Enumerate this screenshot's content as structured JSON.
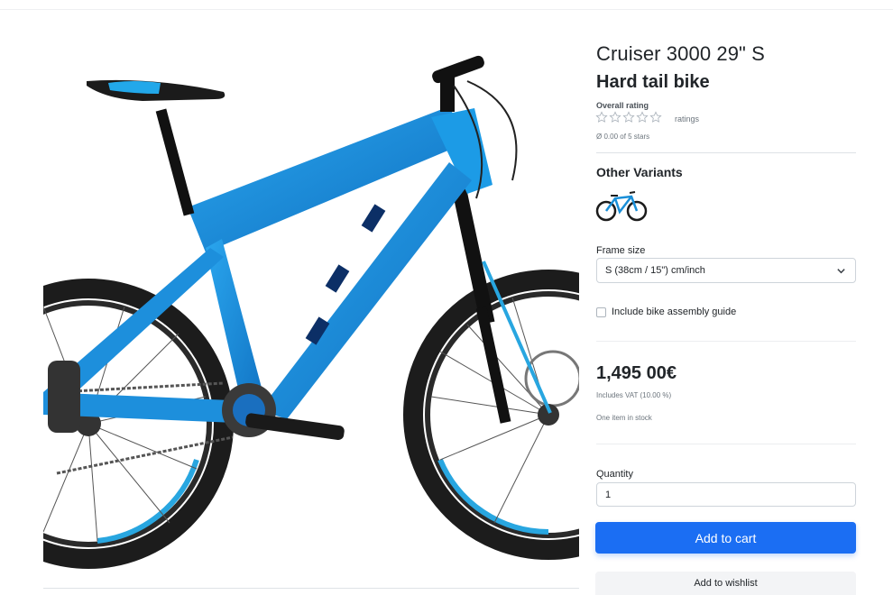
{
  "product": {
    "title": "Cruiser 3000 29\" S",
    "subtitle": "Hard tail bike",
    "image_name": "mountain bike photo",
    "accent_color": "#1b6ef3",
    "frame_color": "#1a8fd8"
  },
  "rating": {
    "title": "Overall rating",
    "stars_filled": 0,
    "stars_total": 5,
    "ratings_label": "ratings",
    "average_text": "Ø 0.00 of 5 stars"
  },
  "variants": {
    "title": "Other Variants",
    "items": [
      {
        "icon": "bike-thumbnail-icon"
      }
    ]
  },
  "frame_size": {
    "label": "Frame size",
    "selected": "S (38cm / 15\") cm/inch"
  },
  "assembly": {
    "label": "Include bike assembly guide",
    "checked": false
  },
  "pricing": {
    "price": "1,495 00€",
    "vat": "Includes VAT (10.00 %)",
    "stock": "One item in stock"
  },
  "quantity": {
    "label": "Quantity",
    "value": "1"
  },
  "actions": {
    "add_to_cart": "Add to cart",
    "add_to_wishlist": "Add to wishlist"
  }
}
